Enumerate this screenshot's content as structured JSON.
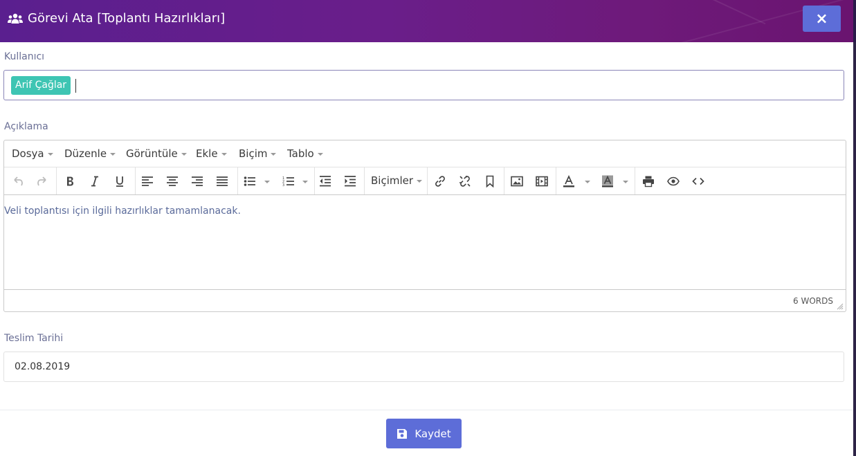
{
  "modal": {
    "title": "Görevi Ata [Toplantı Hazırlıkları]",
    "close_label": "×"
  },
  "user_field": {
    "label": "Kullanıcı",
    "tags": [
      "Arif Çağlar"
    ]
  },
  "description": {
    "label": "Açıklama",
    "menu": [
      "Dosya",
      "Düzenle",
      "Görüntüle",
      "Ekle",
      "Biçim",
      "Tablo"
    ],
    "formats_label": "Biçimler",
    "content": "Veli toplantısı için ilgili hazırlıklar tamamlanacak.",
    "word_count": "6 WORDS"
  },
  "due_date": {
    "label": "Teslim Tarihi",
    "value": "02.08.2019"
  },
  "footer": {
    "save_label": "Kaydet"
  },
  "colors": {
    "primary": "#5d6dd8",
    "tag": "#3ec5b3",
    "header_start": "#5a1f8f",
    "header_end": "#6a1470"
  }
}
